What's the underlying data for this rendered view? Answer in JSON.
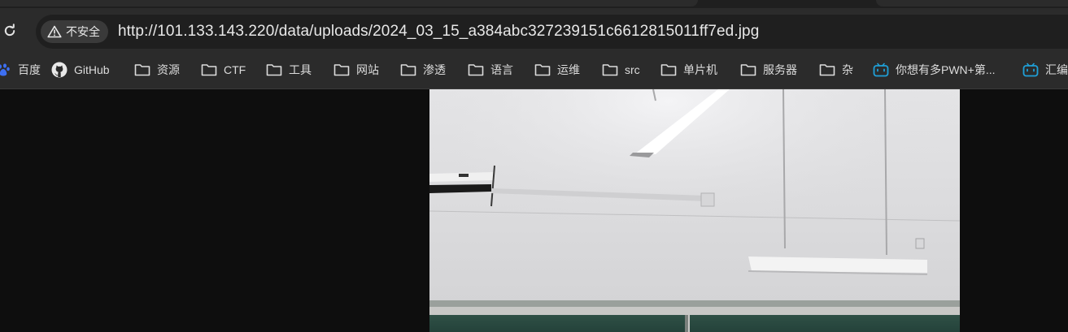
{
  "browser": {
    "reload_icon": "reload-icon",
    "security_icon": "warning-triangle-icon",
    "security_label": "不安全",
    "url": "http://101.133.143.220/data/uploads/2024_03_15_a384abc327239151c6612815011ff7ed.jpg"
  },
  "bookmarks": [
    {
      "label": "百度",
      "icon": "baidu-icon"
    },
    {
      "label": "GitHub",
      "icon": "github-icon"
    },
    {
      "label": "资源",
      "icon": "folder-icon"
    },
    {
      "label": "CTF",
      "icon": "folder-icon"
    },
    {
      "label": "工具",
      "icon": "folder-icon"
    },
    {
      "label": "网站",
      "icon": "folder-icon"
    },
    {
      "label": "渗透",
      "icon": "folder-icon"
    },
    {
      "label": "语言",
      "icon": "folder-icon"
    },
    {
      "label": "运维",
      "icon": "folder-icon"
    },
    {
      "label": "src",
      "icon": "folder-icon"
    },
    {
      "label": "单片机",
      "icon": "folder-icon"
    },
    {
      "label": "服务器",
      "icon": "folder-icon"
    },
    {
      "label": "杂",
      "icon": "folder-icon"
    },
    {
      "label": "你想有多PWN+第...",
      "icon": "bilibili-icon"
    },
    {
      "label": "汇编",
      "icon": "bilibili-icon"
    }
  ],
  "colors": {
    "toolbar_bg": "#2b2b2b",
    "omnibox_bg": "#1f1f1f",
    "viewer_bg": "#0e0e0e",
    "bilibili_blue": "#1fa0d8"
  }
}
